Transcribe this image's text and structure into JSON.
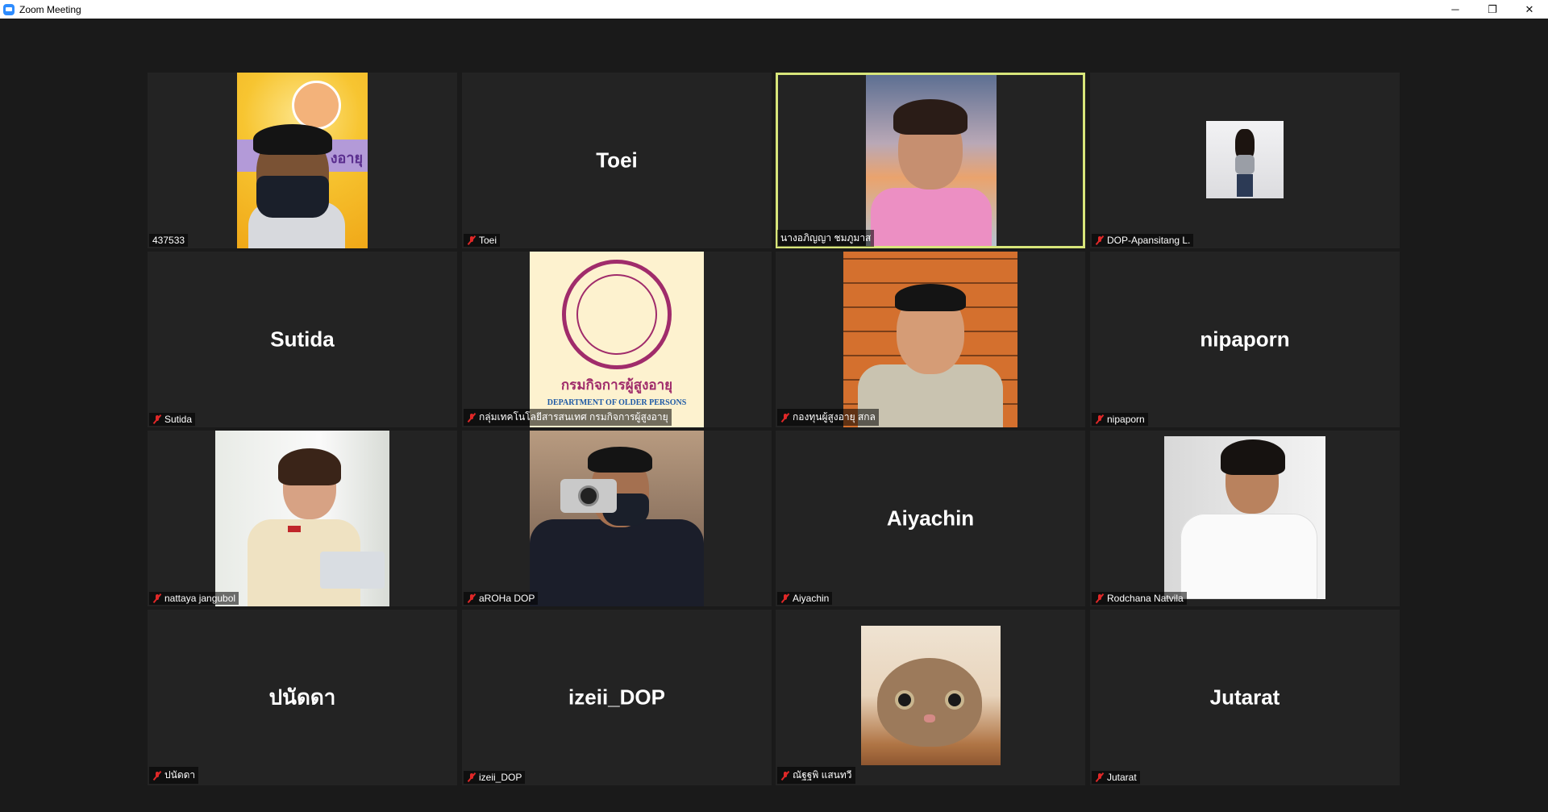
{
  "window": {
    "title": "Zoom Meeting",
    "controls": {
      "minimize": "─",
      "restore": "❐",
      "close": "✕"
    }
  },
  "participants": [
    {
      "name": "437533",
      "big_name": "",
      "muted": false,
      "has_video": true,
      "active": false
    },
    {
      "name": "Toei",
      "big_name": "Toei",
      "muted": true,
      "has_video": false,
      "active": false
    },
    {
      "name": "นางอภิญญา ชมภูมาส",
      "big_name": "",
      "muted": false,
      "has_video": true,
      "active": true
    },
    {
      "name": "DOP-Apansitang L.",
      "big_name": "",
      "muted": true,
      "has_video": true,
      "active": false
    },
    {
      "name": "Sutida",
      "big_name": "Sutida",
      "muted": true,
      "has_video": false,
      "active": false
    },
    {
      "name": "กลุ่มเทคโนโลยีสารสนเทศ กรมกิจการผู้สูงอายุ",
      "big_name": "",
      "muted": true,
      "has_video": true,
      "active": false
    },
    {
      "name": "กองทุนผู้สูงอายุ สกล",
      "big_name": "",
      "muted": true,
      "has_video": true,
      "active": false
    },
    {
      "name": "nipaporn",
      "big_name": "nipaporn",
      "muted": true,
      "has_video": false,
      "active": false
    },
    {
      "name": "nattaya jangubol",
      "big_name": "",
      "muted": true,
      "has_video": true,
      "active": false
    },
    {
      "name": "aROHa DOP",
      "big_name": "",
      "muted": true,
      "has_video": true,
      "active": false
    },
    {
      "name": "Aiyachin",
      "big_name": "Aiyachin",
      "muted": true,
      "has_video": false,
      "active": false
    },
    {
      "name": "Rodchana Natvila",
      "big_name": "",
      "muted": true,
      "has_video": true,
      "active": false
    },
    {
      "name": "ปนัดดา",
      "big_name": "ปนัดดา",
      "muted": true,
      "has_video": false,
      "active": false
    },
    {
      "name": "izeii_DOP",
      "big_name": "izeii_DOP",
      "muted": true,
      "has_video": false,
      "active": false
    },
    {
      "name": "ณัฐฐพิ แสนทวี",
      "big_name": "",
      "muted": true,
      "has_video": true,
      "active": false
    },
    {
      "name": "Jutarat",
      "big_name": "Jutarat",
      "muted": true,
      "has_video": false,
      "active": false
    }
  ],
  "logo_tile": {
    "thai_text": "กรมกิจการผู้สูงอายุ",
    "english_text": "DEPARTMENT OF OLDER PERSONS"
  },
  "cartoon_tile": {
    "banner_text": "งอายุ"
  }
}
